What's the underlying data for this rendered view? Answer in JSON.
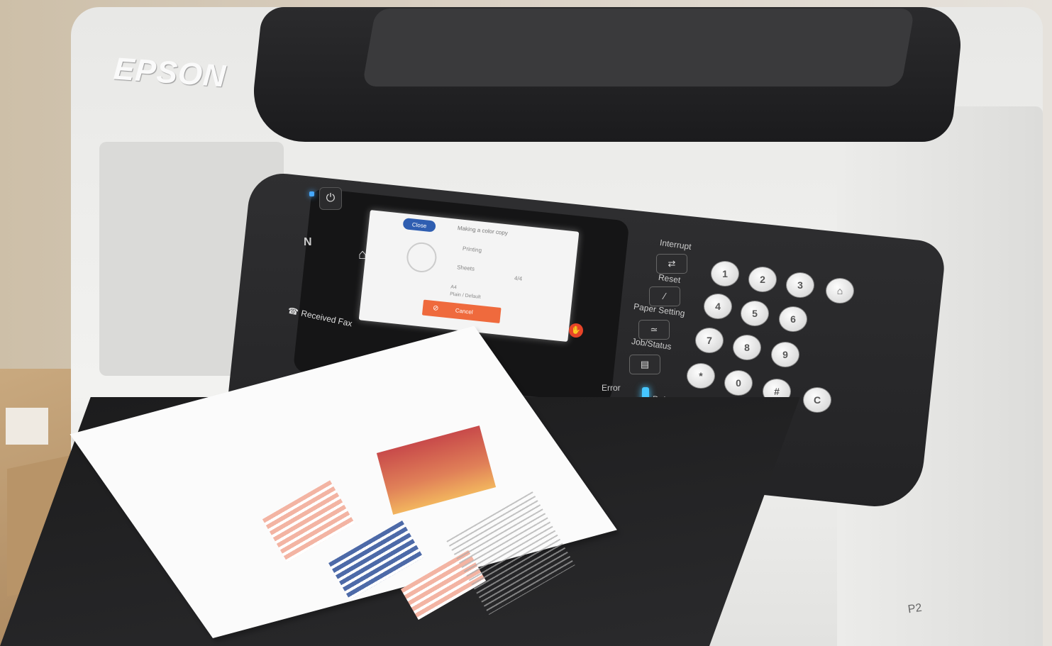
{
  "brand": {
    "logo_text": "EPSON"
  },
  "screen": {
    "close_label": "Close",
    "title": "Making a color copy",
    "status": "Printing",
    "sheets_label": "Sheets",
    "sheets_count": "4/4",
    "paper_info": "A4",
    "paper_info_2": "Plain / Default",
    "cancel_label": "Cancel"
  },
  "panel": {
    "received_fax": "Received Fax",
    "interrupt": "Interrupt",
    "reset": "Reset",
    "paper_setting": "Paper Setting",
    "job_status": "Job/Status",
    "error": "Error",
    "data": "Data"
  },
  "keypad": [
    "1",
    "2",
    "3",
    "4",
    "5",
    "6",
    "7",
    "8",
    "9",
    "*",
    "0",
    "#",
    "C"
  ],
  "tray_label": "P2",
  "colors": {
    "screen_accent": "#2f5eb1",
    "cancel": "#ef6a3d",
    "led": "#46a8ff"
  }
}
